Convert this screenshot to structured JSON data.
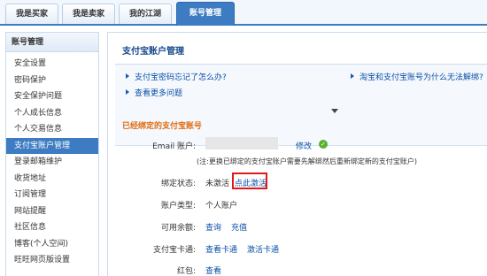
{
  "top_nav": {
    "tabs": [
      {
        "label": "我是买家"
      },
      {
        "label": "我是卖家"
      },
      {
        "label": "我的江湖"
      },
      {
        "label": "账号管理",
        "active": true
      }
    ]
  },
  "sidebar": {
    "title": "账号管理",
    "items": [
      {
        "label": "安全设置"
      },
      {
        "label": "密码保护"
      },
      {
        "label": "安全保护问题"
      },
      {
        "label": "个人成长信息"
      },
      {
        "label": "个人交易信息"
      },
      {
        "label": "支付宝账户管理",
        "active": true
      },
      {
        "label": "登录邮箱维护"
      },
      {
        "label": "收货地址"
      },
      {
        "label": "订阅管理"
      },
      {
        "label": "网站提醒"
      },
      {
        "label": "社区信息"
      },
      {
        "label": "博客(个人空间)"
      },
      {
        "label": "旺旺网页版设置"
      }
    ]
  },
  "main": {
    "title": "支付宝账户管理",
    "help": {
      "link1": "支付宝密码忘记了怎么办?",
      "link2": "淘宝和支付宝账号为什么无法解绑?",
      "link3": "查看更多问题"
    },
    "section_title": "已经绑定的支付宝账号",
    "email": {
      "label": "Email 账户:",
      "edit_link": "修改"
    },
    "note": "(注:更换已绑定的支付宝账户需要先解绑然后重新绑定新的支付宝账户)",
    "binding": {
      "label": "绑定状态:",
      "value": "未激活",
      "activate_link": "点此激活"
    },
    "account_type": {
      "label": "账户类型:",
      "value": "个人账户"
    },
    "balance": {
      "label": "可用余额:",
      "query_link": "查询",
      "recharge_link": "充值"
    },
    "card": {
      "label": "支付宝卡通:",
      "query_link": "查看卡通",
      "activate_link": "激活卡通"
    },
    "red_packet": {
      "label": "红包:",
      "view_link": "查看"
    }
  },
  "colors": {
    "nav_blue": "#3d7cc2",
    "title_blue": "#15468b",
    "link_blue": "#0b4fa8",
    "section_orange": "#e06d14",
    "highlight_red": "#e01a1a"
  }
}
